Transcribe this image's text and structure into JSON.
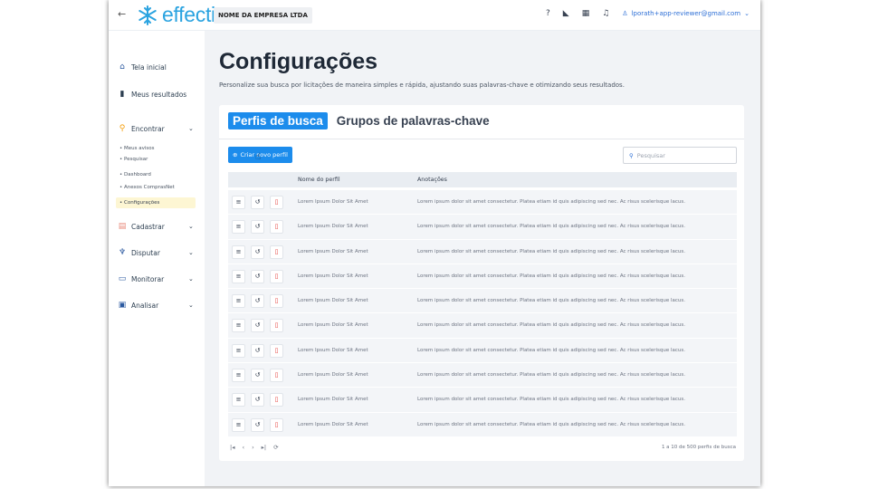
{
  "header": {
    "back": "←",
    "logo_text": "effecti",
    "company": "NOME DA EMPRESA LTDA",
    "user_email": "lporath+app-reviewer@gmail.com"
  },
  "sidebar": {
    "items": [
      {
        "label": "Tela inicial",
        "icon": "home-icon"
      },
      {
        "label": "Meus resultados",
        "icon": "bar-chart-icon"
      },
      {
        "label": "Encontrar",
        "icon": "search-icon"
      },
      {
        "label": "Cadastrar",
        "icon": "clipboard-icon"
      },
      {
        "label": "Disputar",
        "icon": "trophy-icon"
      },
      {
        "label": "Monitorar",
        "icon": "chat-icon"
      },
      {
        "label": "Analisar",
        "icon": "analytics-icon"
      }
    ],
    "sub_items": [
      "Meus avisos",
      "Pesquisar",
      "Dashboard",
      "Anexos ComprasNet",
      "Configurações"
    ]
  },
  "page": {
    "title": "Configurações",
    "subtitle": "Personalize sua busca por licitações de maneira simples e rápida, ajustando suas palavras-chave e otimizando seus resultados."
  },
  "tabs": [
    "Perfis de busca",
    "Grupos de palavras-chave"
  ],
  "toolbar": {
    "create_label": "Criar novo perfil",
    "search_placeholder": "Pesquisar"
  },
  "table": {
    "columns": [
      "Nome do perfil",
      "Anotações"
    ],
    "rows": [
      {
        "name": "Lorem Ipsum Dolor Sit Amet",
        "note": "Lorem ipsum dolor sit amet consectetur. Platea etiam id quis adipiscing sed nec. Ac risus scelerisque lacus."
      },
      {
        "name": "Lorem Ipsum Dolor Sit Amet",
        "note": "Lorem ipsum dolor sit amet consectetur. Platea etiam id quis adipiscing sed nec. Ac risus scelerisque lacus."
      },
      {
        "name": "Lorem Ipsum Dolor Sit Amet",
        "note": "Lorem ipsum dolor sit amet consectetur. Platea etiam id quis adipiscing sed nec. Ac risus scelerisque lacus."
      },
      {
        "name": "Lorem Ipsum Dolor Sit Amet",
        "note": "Lorem ipsum dolor sit amet consectetur. Platea etiam id quis adipiscing sed nec. Ac risus scelerisque lacus."
      },
      {
        "name": "Lorem Ipsum Dolor Sit Amet",
        "note": "Lorem ipsum dolor sit amet consectetur. Platea etiam id quis adipiscing sed nec. Ac risus scelerisque lacus."
      },
      {
        "name": "Lorem Ipsum Dolor Sit Amet",
        "note": "Lorem ipsum dolor sit amet consectetur. Platea etiam id quis adipiscing sed nec. Ac risus scelerisque lacus."
      },
      {
        "name": "Lorem Ipsum Dolor Sit Amet",
        "note": "Lorem ipsum dolor sit amet consectetur. Platea etiam id quis adipiscing sed nec. Ac risus scelerisque lacus."
      },
      {
        "name": "Lorem Ipsum Dolor Sit Amet",
        "note": "Lorem ipsum dolor sit amet consectetur. Platea etiam id quis adipiscing sed nec. Ac risus scelerisque lacus."
      },
      {
        "name": "Lorem Ipsum Dolor Sit Amet",
        "note": "Lorem ipsum dolor sit amet consectetur. Platea etiam id quis adipiscing sed nec. Ac risus scelerisque lacus."
      },
      {
        "name": "Lorem Ipsum Dolor Sit Amet",
        "note": "Lorem ipsum dolor sit amet consectetur. Platea etiam id quis adipiscing sed nec. Ac risus scelerisque lacus."
      }
    ]
  },
  "pagination": {
    "info": "1 a 10 de 500 perfis de busca"
  },
  "colors": {
    "accent": "#1c8cec",
    "logo": "#2aa3e0",
    "delete": "#e53935",
    "active_sub_bg": "#fdf6d3"
  }
}
